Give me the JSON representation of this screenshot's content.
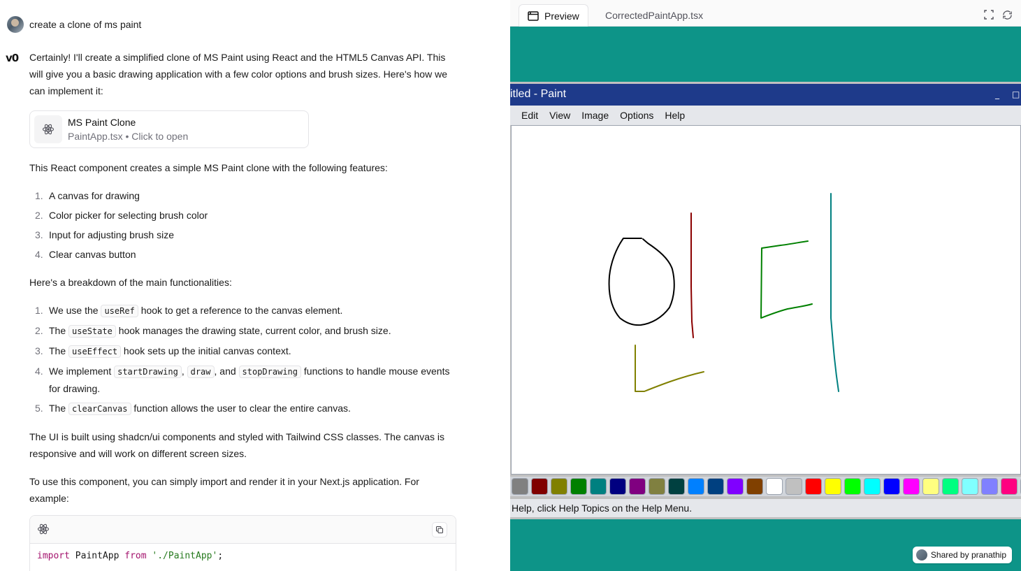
{
  "chat": {
    "user_message": "create a clone of ms paint",
    "assistant_logo": "v0",
    "intro": "Certainly! I'll create a simplified clone of MS Paint using React and the HTML5 Canvas API. This will give you a basic drawing application with a few color options and brush sizes. Here's how we can implement it:",
    "file_card": {
      "title": "MS Paint Clone",
      "filename": "PaintApp.tsx",
      "action": "Click to open",
      "separator": " • "
    },
    "features_intro": "This React component creates a simple MS Paint clone with the following features:",
    "features": [
      "A canvas for drawing",
      "Color picker for selecting brush color",
      "Input for adjusting brush size",
      "Clear canvas button"
    ],
    "breakdown_intro": "Here's a breakdown of the main functionalities:",
    "breakdown": {
      "i1": {
        "pre": "We use the ",
        "code": "useRef",
        "post": " hook to get a reference to the canvas element."
      },
      "i2": {
        "pre": "The ",
        "code": "useState",
        "post": " hook manages the drawing state, current color, and brush size."
      },
      "i3": {
        "pre": "The ",
        "code": "useEffect",
        "post": " hook sets up the initial canvas context."
      },
      "i4": {
        "pre": "We implement ",
        "code1": "startDrawing",
        "sep1": ", ",
        "code2": "draw",
        "sep2": ", and ",
        "code3": "stopDrawing",
        "post": " functions to handle mouse events for drawing."
      },
      "i5": {
        "pre": "The ",
        "code": "clearCanvas",
        "post": " function allows the user to clear the entire canvas."
      }
    },
    "ui_note": "The UI is built using shadcn/ui components and styled with Tailwind CSS classes. The canvas is responsive and will work on different screen sizes.",
    "usage_intro": "To use this component, you can simply import and render it in your Next.js application. For example:",
    "code": {
      "kw_import": "import",
      "ident": " PaintApp ",
      "kw_from": "from",
      "string": "'./PaintApp'",
      "semicolon": ";"
    }
  },
  "preview": {
    "tab_preview": "Preview",
    "tab_file": "CorrectedPaintApp.tsx",
    "window_title": "itled - Paint",
    "window_buttons": {
      "minimize": "_",
      "maximize": "□"
    },
    "menu": [
      "Edit",
      "View",
      "Image",
      "Options",
      "Help"
    ],
    "palette": [
      "#808080",
      "#800000",
      "#808000",
      "#008000",
      "#008080",
      "#000080",
      "#800080",
      "#808040",
      "#004040",
      "#0080ff",
      "#004080",
      "#8000ff",
      "#804000",
      "#ffffff",
      "#c0c0c0",
      "#ff0000",
      "#ffff00",
      "#00ff00",
      "#00ffff",
      "#0000ff",
      "#ff00ff",
      "#ffff80",
      "#00ff80",
      "#80ffff",
      "#8080ff",
      "#ff0080",
      "#ff8040"
    ],
    "status_text": "Help, click Help Topics on the Help Menu.",
    "shared_label": "Shared by ",
    "shared_user": "pranathip",
    "colors": {
      "teal_bg": "#0d9488",
      "title_bar": "#1e3a8a"
    },
    "strokes": [
      {
        "color": "#000000"
      },
      {
        "color": "#8b0000"
      },
      {
        "color": "#008000"
      },
      {
        "color": "#008080"
      },
      {
        "color": "#808000"
      }
    ]
  }
}
